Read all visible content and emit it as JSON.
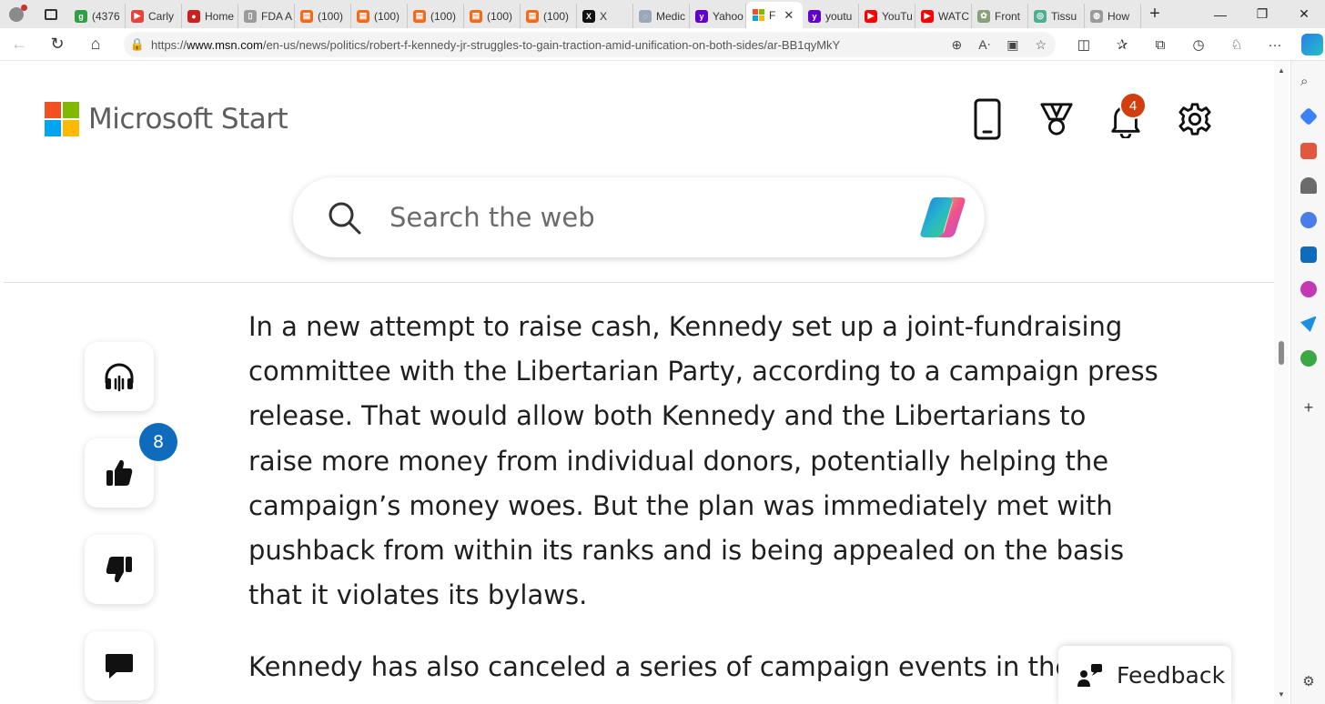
{
  "browser": {
    "tabs": [
      {
        "label": "(4376",
        "color": "#2ea043",
        "glyph": "g"
      },
      {
        "label": "Carly",
        "color": "#e8433a",
        "glyph": "▶"
      },
      {
        "label": "Home",
        "color": "#cc1f1f",
        "glyph": "●"
      },
      {
        "label": "FDA A",
        "color": "#9a9a9a",
        "glyph": "▯"
      },
      {
        "label": "(100)",
        "color": "#f26b1d",
        "glyph": "▤"
      },
      {
        "label": "(100)",
        "color": "#f26b1d",
        "glyph": "▤"
      },
      {
        "label": "(100)",
        "color": "#f26b1d",
        "glyph": "▤"
      },
      {
        "label": "(100)",
        "color": "#f26b1d",
        "glyph": "▤"
      },
      {
        "label": "(100)",
        "color": "#f26b1d",
        "glyph": "▤"
      },
      {
        "label": "X",
        "color": "#111111",
        "glyph": "X"
      },
      {
        "label": "Medic",
        "color": "#9aa8b8",
        "glyph": "◌"
      },
      {
        "label": "Yahoo",
        "color": "#6001d2",
        "glyph": "y"
      },
      {
        "label": "F",
        "color": "#ffffff",
        "glyph": "",
        "active": true
      },
      {
        "label": "youtu",
        "color": "#6001d2",
        "glyph": "y"
      },
      {
        "label": "YouTu",
        "color": "#ff0000",
        "glyph": "▶"
      },
      {
        "label": "WATC",
        "color": "#ff0000",
        "glyph": "▶"
      },
      {
        "label": "Front",
        "color": "#8aa07a",
        "glyph": "✿"
      },
      {
        "label": "Tissu",
        "color": "#4caf8f",
        "glyph": "◎"
      },
      {
        "label": "How",
        "color": "#9a9a9a",
        "glyph": "◍"
      }
    ],
    "url": "https://www.msn.com/en-us/news/politics/robert-f-kennedy-jr-struggles-to-gain-traction-amid-unification-on-both-sides/ar-BB1qyMkY",
    "url_host": "www.msn.com",
    "url_prefix": "https://",
    "url_path": "/en-us/news/politics/robert-f-kennedy-jr-struggles-to-gain-traction-amid-unification-on-both-sides/ar-BB1qyMkY"
  },
  "header": {
    "brand": "Microsoft Start",
    "notification_count": "4"
  },
  "search": {
    "placeholder": "Search the web"
  },
  "rail": {
    "like_count": "8"
  },
  "article": {
    "paragraphs": [
      "In a new attempt to raise cash, Kennedy set up a joint-fundraising committee with the Libertarian Party, according to a campaign press release. That would allow both Kennedy and the Libertarians to raise more money from individual donors, potentially helping the campaign’s money woes. But the plan was immediately met with pushback from within its ranks and is being appealed on the basis that it violates its bylaws.",
      "Kennedy has also canceled a series of campaign events in the la"
    ]
  },
  "feedback": {
    "label": "Feedback"
  },
  "colors": {
    "notification_badge": "#d23e0f",
    "like_badge": "#0f6cbd"
  }
}
